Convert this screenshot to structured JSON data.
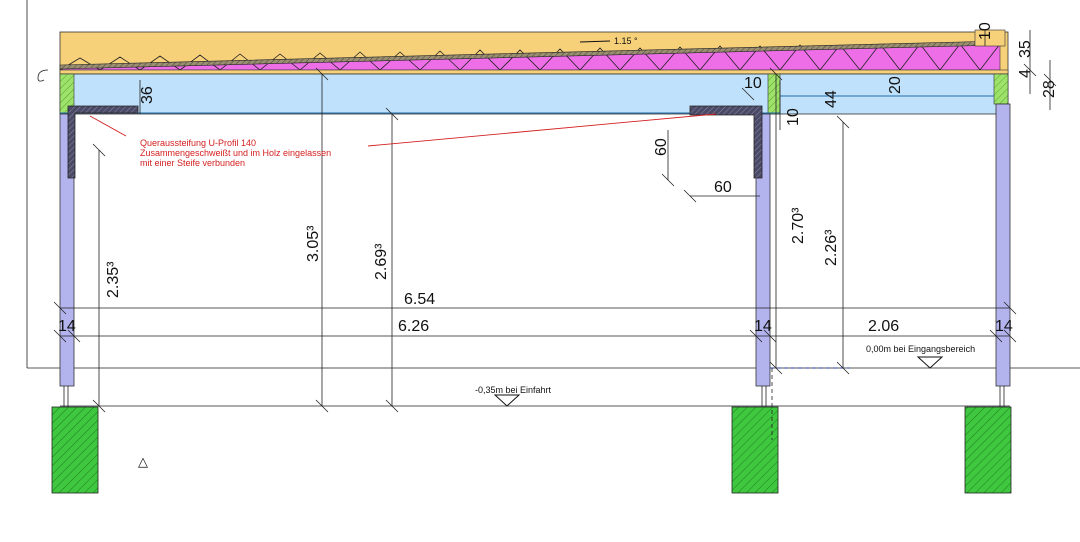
{
  "annotations": {
    "slope": "1.15 °",
    "note_line1": "Queraussteifung U-Profil 140",
    "note_line2": "Zusammengeschweißt und im Holz eingelassen",
    "note_line3": "mit einer Steife verbunden",
    "level_entrance": "0,00m bei Eingangsbereich",
    "level_driveway": "-0,35m bei Einfahrt",
    "marker": "△"
  },
  "dimensions": {
    "d10_top": "10",
    "d35": "35",
    "d4": "4",
    "d28": "28",
    "d36": "36",
    "d10_mid": "10",
    "d10_vert": "10",
    "d44": "44",
    "d20": "20",
    "d60_vert": "60",
    "d60_horiz": "60",
    "d305": "3.05³",
    "d269": "2.69³",
    "d235": "2.35³",
    "d270": "2.70³",
    "d226": "2.26³",
    "d654": "6.54",
    "d626": "6.26",
    "d206": "2.06",
    "d14_left": "14",
    "d14_mid": "14",
    "d14_right": "14"
  },
  "colors": {
    "roof_layer": "#f7d07a",
    "insulation": "#ee6ee8",
    "beam": "#bfe1fb",
    "column": "#b3b3ee",
    "foundation": "#3fc83f",
    "wood_end": "#9de36a",
    "steel_profile": "#4a4a66",
    "red_note": "#d42020"
  }
}
